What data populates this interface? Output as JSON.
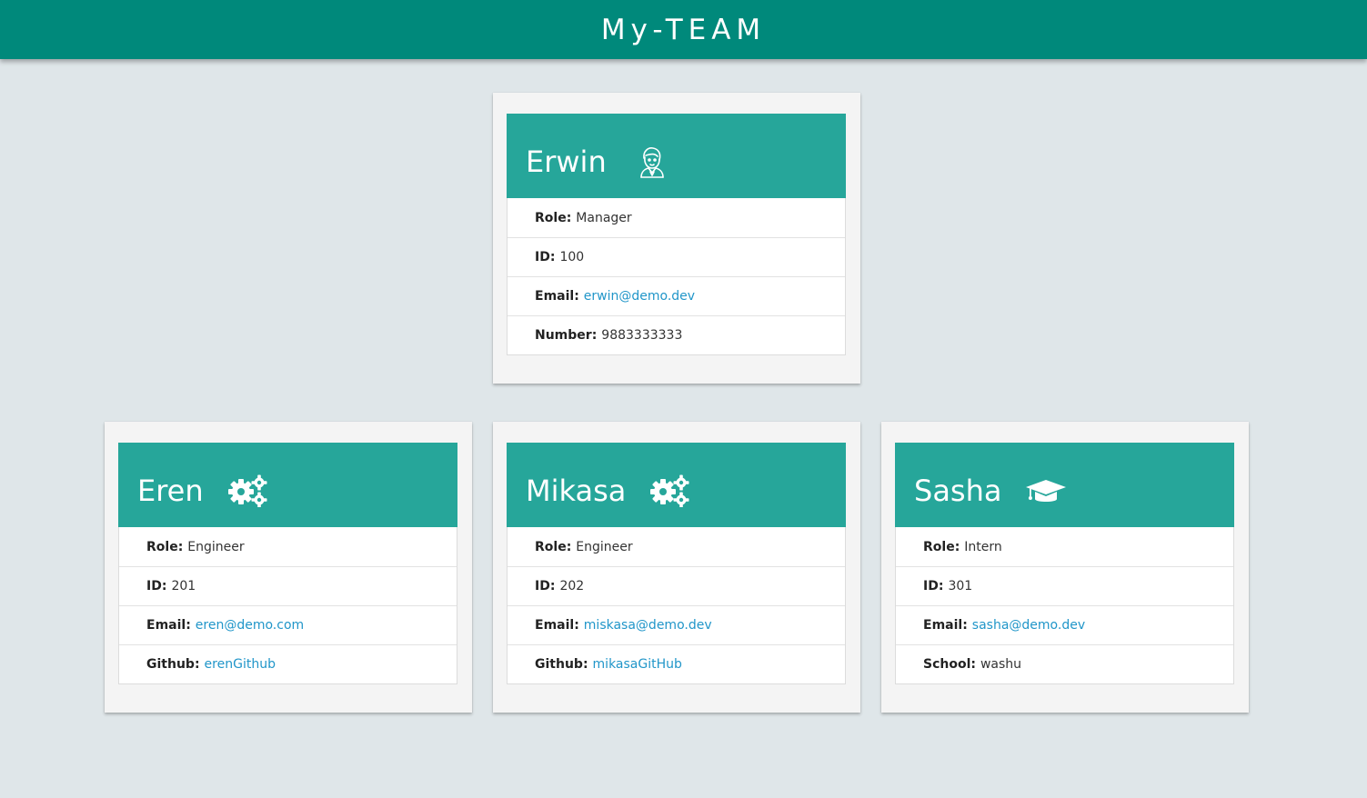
{
  "navbar": {
    "title": "My-TEAM"
  },
  "manager": {
    "name": "Erwin",
    "icon": "user-tie-icon",
    "role_label": "Role:",
    "role": "Manager",
    "id_label": "ID:",
    "id": "100",
    "email_label": "Email:",
    "email": "erwin@demo.dev",
    "extra_label": "Number:",
    "extra": "9883333333"
  },
  "engineer1": {
    "name": "Eren",
    "icon": "cogs-icon",
    "role_label": "Role:",
    "role": "Engineer",
    "id_label": "ID:",
    "id": "201",
    "email_label": "Email:",
    "email": "eren@demo.com",
    "extra_label": "Github:",
    "extra": "erenGithub"
  },
  "engineer2": {
    "name": "Mikasa",
    "icon": "cogs-icon",
    "role_label": "Role:",
    "role": "Engineer",
    "id_label": "ID:",
    "id": "202",
    "email_label": "Email:",
    "email": "miskasa@demo.dev",
    "extra_label": "Github:",
    "extra": "mikasaGitHub"
  },
  "intern": {
    "name": "Sasha",
    "icon": "graduation-cap-icon",
    "role_label": "Role:",
    "role": "Intern",
    "id_label": "ID:",
    "id": "301",
    "email_label": "Email:",
    "email": "sasha@demo.dev",
    "extra_label": "School:",
    "extra": "washu"
  },
  "colors": {
    "navbar": "#00897b",
    "card_header": "#26a69a",
    "background": "#dfe6e9",
    "link": "#2196c9"
  }
}
